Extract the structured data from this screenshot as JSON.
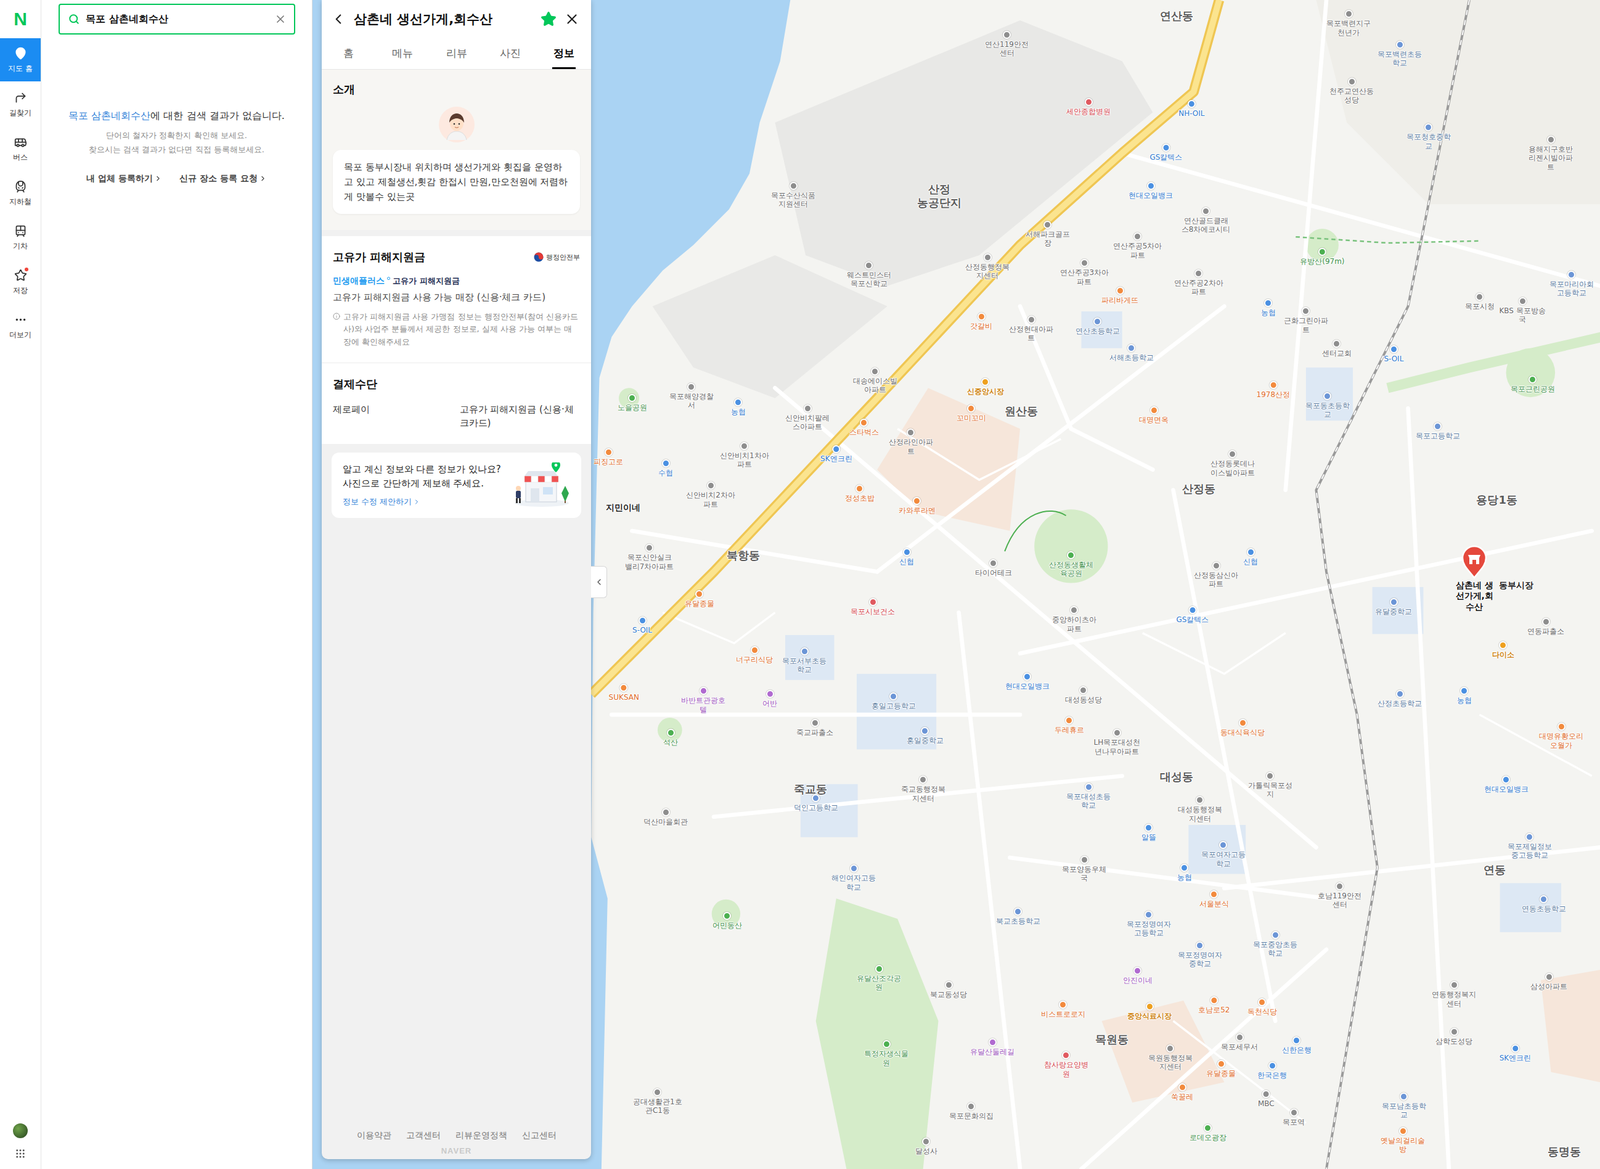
{
  "nav": {
    "logo": "N",
    "items": [
      {
        "label": "지도 홈",
        "selected": true,
        "badge": false
      },
      {
        "label": "길찾기",
        "selected": false,
        "badge": false
      },
      {
        "label": "버스",
        "selected": false,
        "badge": false
      },
      {
        "label": "지하철",
        "selected": false,
        "badge": false
      },
      {
        "label": "기차",
        "selected": false,
        "badge": false
      },
      {
        "label": "저장",
        "selected": false,
        "badge": true
      },
      {
        "label": "더보기",
        "selected": false,
        "badge": false
      }
    ]
  },
  "search": {
    "query": "목포 삼촌네회수산",
    "noResult": {
      "keyword": "목포 삼촌네회수산",
      "message": "에 대한 검색 결과가 없습니다.",
      "hints": [
        "단어의 철자가 정확한지 확인해 보세요.",
        "찾으시는 검색 결과가 없다면 직접 등록해보세요."
      ],
      "links": [
        "내 업체 등록하기",
        "신규 장소 등록 요청"
      ]
    }
  },
  "place": {
    "title": "삼촌네 생선가게,회수산",
    "saved": true,
    "tabs": [
      {
        "label": "홈",
        "selected": false
      },
      {
        "label": "메뉴",
        "selected": false
      },
      {
        "label": "리뷰",
        "selected": false
      },
      {
        "label": "사진",
        "selected": false
      },
      {
        "label": "정보",
        "selected": true
      }
    ],
    "intro": {
      "heading": "소개",
      "text": "목포 동부시장내 위치하며 생선가게와 횟집을 운영하고 있고 제철생선,횟감 한접시 만원,만오천원에 저렴하게 맛볼수 있는곳"
    },
    "subsidy": {
      "heading": "고유가 피해지원금",
      "agency": "행정안전부",
      "brand": "민생애플러스",
      "badge": "고유가 피해지원금",
      "desc": "고유가 피해지원금 사용 가능 매장 (신용·체크 카드)",
      "note": "고유가 피해지원금 사용 가맹점 정보는 행정안전부(참여 신용카드사)와 사업주 분들께서 제공한 정보로, 실제 사용 가능 여부는 매장에 확인해주세요"
    },
    "payment": {
      "heading": "결제수단",
      "methods": [
        "제로페이",
        "고유가 피해지원금 (신용·체크카드)"
      ]
    },
    "suggest": {
      "lines": [
        "알고 계신 정보와 다른 정보가 있나요?",
        "사진으로 간단하게 제보해 주세요."
      ],
      "link": "정보 수정 제안하기"
    },
    "footer": [
      "이용약관",
      "고객센터",
      "리뷰운영정책",
      "신고센터"
    ],
    "footerLogo": "NAVER"
  },
  "map": {
    "pin": {
      "label": "삼촌네 생선가게,회수산",
      "selected": true
    },
    "labels": [
      {
        "text": "연산동",
        "kind": "area"
      },
      {
        "text": "원산동",
        "kind": "area"
      },
      {
        "text": "산정동",
        "kind": "area"
      },
      {
        "text": "용당1동",
        "kind": "area"
      },
      {
        "text": "북항동",
        "kind": "area"
      },
      {
        "text": "대성동",
        "kind": "area"
      },
      {
        "text": "죽교동",
        "kind": "area"
      },
      {
        "text": "연동",
        "kind": "area"
      },
      {
        "text": "목원동",
        "kind": "area"
      },
      {
        "text": "산정 농공단지",
        "kind": "area"
      },
      {
        "text": "연산119안전센터",
        "kind": "poi"
      },
      {
        "text": "목포백련지구천년가",
        "kind": "poi"
      },
      {
        "text": "목포백련초등학교",
        "kind": "school"
      },
      {
        "text": "천주교연산동성당",
        "kind": "poi"
      },
      {
        "text": "세안종합병원",
        "kind": "hospital"
      },
      {
        "text": "NH-OIL",
        "kind": "fuel"
      },
      {
        "text": "목포청호중학교",
        "kind": "school"
      },
      {
        "text": "용해지구호반리젠시빌아파트",
        "kind": "poi"
      },
      {
        "text": "GS칼텍스",
        "kind": "fuel"
      },
      {
        "text": "목포수산식품지원센터",
        "kind": "poi"
      },
      {
        "text": "현대오일뱅크",
        "kind": "fuel"
      },
      {
        "text": "연산골드클래스8차에코시티",
        "kind": "poi"
      },
      {
        "text": "서해파크골프장",
        "kind": "poi"
      },
      {
        "text": "연산주공5차아파트",
        "kind": "poi"
      },
      {
        "text": "산정동행정복지센터",
        "kind": "poi"
      },
      {
        "text": "유방산(97m)",
        "kind": "park"
      },
      {
        "text": "웨스트민스터목포신학교",
        "kind": "poi"
      },
      {
        "text": "연산주공3차아파트",
        "kind": "poi"
      },
      {
        "text": "연산주공2차아파트",
        "kind": "poi"
      },
      {
        "text": "목포마리아회고등학교",
        "kind": "school"
      },
      {
        "text": "파리바게뜨",
        "kind": "food"
      },
      {
        "text": "목포시청",
        "kind": "poi"
      },
      {
        "text": "KBS 목포방송국",
        "kind": "poi"
      },
      {
        "text": "농협",
        "kind": "bank"
      },
      {
        "text": "근화그린아파트",
        "kind": "poi"
      },
      {
        "text": "갓갈비",
        "kind": "food"
      },
      {
        "text": "산정현대아파트",
        "kind": "poi"
      },
      {
        "text": "연산초등학교",
        "kind": "school"
      },
      {
        "text": "센터교회",
        "kind": "poi"
      },
      {
        "text": "서해초등학교",
        "kind": "school"
      },
      {
        "text": "S-OIL",
        "kind": "fuel"
      },
      {
        "text": "목포동초등학교",
        "kind": "school"
      },
      {
        "text": "목포해양경찰서",
        "kind": "poi"
      },
      {
        "text": "대송에이스빌아파트",
        "kind": "poi"
      },
      {
        "text": "신중앙시장",
        "kind": "shop"
      },
      {
        "text": "1978산정",
        "kind": "food"
      },
      {
        "text": "목포근린공원",
        "kind": "park"
      },
      {
        "text": "노을공원",
        "kind": "park"
      },
      {
        "text": "신안비치팔레스아파트",
        "kind": "poi"
      },
      {
        "text": "꼬미꼬미",
        "kind": "food"
      },
      {
        "text": "대명면옥",
        "kind": "food"
      },
      {
        "text": "농협",
        "kind": "bank"
      },
      {
        "text": "산정라인아파트",
        "kind": "poi"
      },
      {
        "text": "스타벅스",
        "kind": "food"
      },
      {
        "text": "목포고등학교",
        "kind": "school"
      },
      {
        "text": "신안비치1차아파트",
        "kind": "poi"
      },
      {
        "text": "SK엔크린",
        "kind": "fuel"
      },
      {
        "text": "산정동롯데나이스빌아파트",
        "kind": "poi"
      },
      {
        "text": "피징고로",
        "kind": "food"
      },
      {
        "text": "수협",
        "kind": "bank"
      },
      {
        "text": "정성초밥",
        "kind": "food"
      },
      {
        "text": "카와루라멘",
        "kind": "food"
      },
      {
        "text": "신안비치2차아파트",
        "kind": "poi"
      },
      {
        "text": "지민이네",
        "kind": "place"
      },
      {
        "text": "신협",
        "kind": "bank"
      },
      {
        "text": "목포신안실크밸리7차아파트",
        "kind": "poi"
      },
      {
        "text": "산정동생활체육공원",
        "kind": "park"
      },
      {
        "text": "타이어테크",
        "kind": "poi"
      },
      {
        "text": "산정동삼신아파트",
        "kind": "poi"
      },
      {
        "text": "신협",
        "kind": "bank"
      },
      {
        "text": "유달중학교",
        "kind": "school"
      },
      {
        "text": "연동파출소",
        "kind": "poi"
      },
      {
        "text": "동부시장",
        "kind": "place"
      },
      {
        "text": "목포시보건소",
        "kind": "hospital"
      },
      {
        "text": "중앙하이츠아파트",
        "kind": "poi"
      },
      {
        "text": "GS칼텍스",
        "kind": "fuel"
      },
      {
        "text": "S-OIL",
        "kind": "fuel"
      },
      {
        "text": "유달종물",
        "kind": "food"
      },
      {
        "text": "다이소",
        "kind": "shop"
      },
      {
        "text": "너구리식당",
        "kind": "food"
      },
      {
        "text": "목포서부초등학교",
        "kind": "school"
      },
      {
        "text": "SUKSAN",
        "kind": "food"
      },
      {
        "text": "바반트관광호텔",
        "kind": "lodging"
      },
      {
        "text": "어반",
        "kind": "lodging"
      },
      {
        "text": "현대오일뱅크",
        "kind": "fuel"
      },
      {
        "text": "대성동성당",
        "kind": "poi"
      },
      {
        "text": "산정초등학교",
        "kind": "school"
      },
      {
        "text": "농협",
        "kind": "bank"
      },
      {
        "text": "석산",
        "kind": "park"
      },
      {
        "text": "홍일고등학교",
        "kind": "school"
      },
      {
        "text": "두레휴르",
        "kind": "food"
      },
      {
        "text": "LH목포대성천년나무아파트",
        "kind": "poi"
      },
      {
        "text": "동대식육식당",
        "kind": "food"
      },
      {
        "text": "대명유황오리오월가",
        "kind": "food"
      },
      {
        "text": "죽교파출소",
        "kind": "poi"
      },
      {
        "text": "홍일중학교",
        "kind": "school"
      },
      {
        "text": "죽교동행정복지센터",
        "kind": "poi"
      },
      {
        "text": "가톨릭목포성지",
        "kind": "poi"
      },
      {
        "text": "목포대성초등학교",
        "kind": "school"
      },
      {
        "text": "대성동행정복지센터",
        "kind": "poi"
      },
      {
        "text": "현대오일뱅크",
        "kind": "fuel"
      },
      {
        "text": "덕인고등학교",
        "kind": "school"
      },
      {
        "text": "덕산마을회관",
        "kind": "poi"
      },
      {
        "text": "알뜰",
        "kind": "fuel"
      },
      {
        "text": "목포여자고등학교",
        "kind": "school"
      },
      {
        "text": "목포제일정보중고등학교",
        "kind": "school"
      },
      {
        "text": "목포양동우체국",
        "kind": "poi"
      },
      {
        "text": "해인여자고등학교",
        "kind": "school"
      },
      {
        "text": "농협",
        "kind": "bank"
      },
      {
        "text": "호남119안전센터",
        "kind": "poi"
      },
      {
        "text": "연동초등학교",
        "kind": "school"
      },
      {
        "text": "서울분식",
        "kind": "food"
      },
      {
        "text": "어민동산",
        "kind": "park"
      },
      {
        "text": "목포정명여자고등학교",
        "kind": "school"
      },
      {
        "text": "북교초등학교",
        "kind": "school"
      },
      {
        "text": "목포정명여자중학교",
        "kind": "school"
      },
      {
        "text": "목포중앙초등학교",
        "kind": "school"
      },
      {
        "text": "유달산조각공원",
        "kind": "park"
      },
      {
        "text": "북교동성당",
        "kind": "poi"
      },
      {
        "text": "안진이네",
        "kind": "lodging"
      },
      {
        "text": "연동행정복지센터",
        "kind": "poi"
      },
      {
        "text": "삼성아파트",
        "kind": "poi"
      },
      {
        "text": "중앙식료시장",
        "kind": "shop"
      },
      {
        "text": "호남로52",
        "kind": "food"
      },
      {
        "text": "독천식당",
        "kind": "food"
      },
      {
        "text": "비스트로로지",
        "kind": "food"
      },
      {
        "text": "특정자생식물원",
        "kind": "park"
      },
      {
        "text": "유달산둘레길",
        "kind": "lodging"
      },
      {
        "text": "참사랑요양병원",
        "kind": "hospital"
      },
      {
        "text": "목원동행정복지센터",
        "kind": "poi"
      },
      {
        "text": "목포세무서",
        "kind": "poi"
      },
      {
        "text": "신한은행",
        "kind": "bank"
      },
      {
        "text": "삼학도성당",
        "kind": "poi"
      },
      {
        "text": "SK엔크린",
        "kind": "fuel"
      },
      {
        "text": "유달종물",
        "kind": "food"
      },
      {
        "text": "한국은행",
        "kind": "bank"
      },
      {
        "text": "쑥꿀레",
        "kind": "food"
      },
      {
        "text": "MBC",
        "kind": "poi"
      },
      {
        "text": "목포남초등학교",
        "kind": "school"
      },
      {
        "text": "목포역",
        "kind": "poi"
      },
      {
        "text": "목포문화의집",
        "kind": "poi"
      },
      {
        "text": "로데오광장",
        "kind": "park"
      },
      {
        "text": "옛날의걸리술방",
        "kind": "food"
      },
      {
        "text": "공대생활관1호관C1동",
        "kind": "poi"
      },
      {
        "text": "달성사",
        "kind": "poi"
      },
      {
        "text": "동명동",
        "kind": "area"
      }
    ]
  }
}
